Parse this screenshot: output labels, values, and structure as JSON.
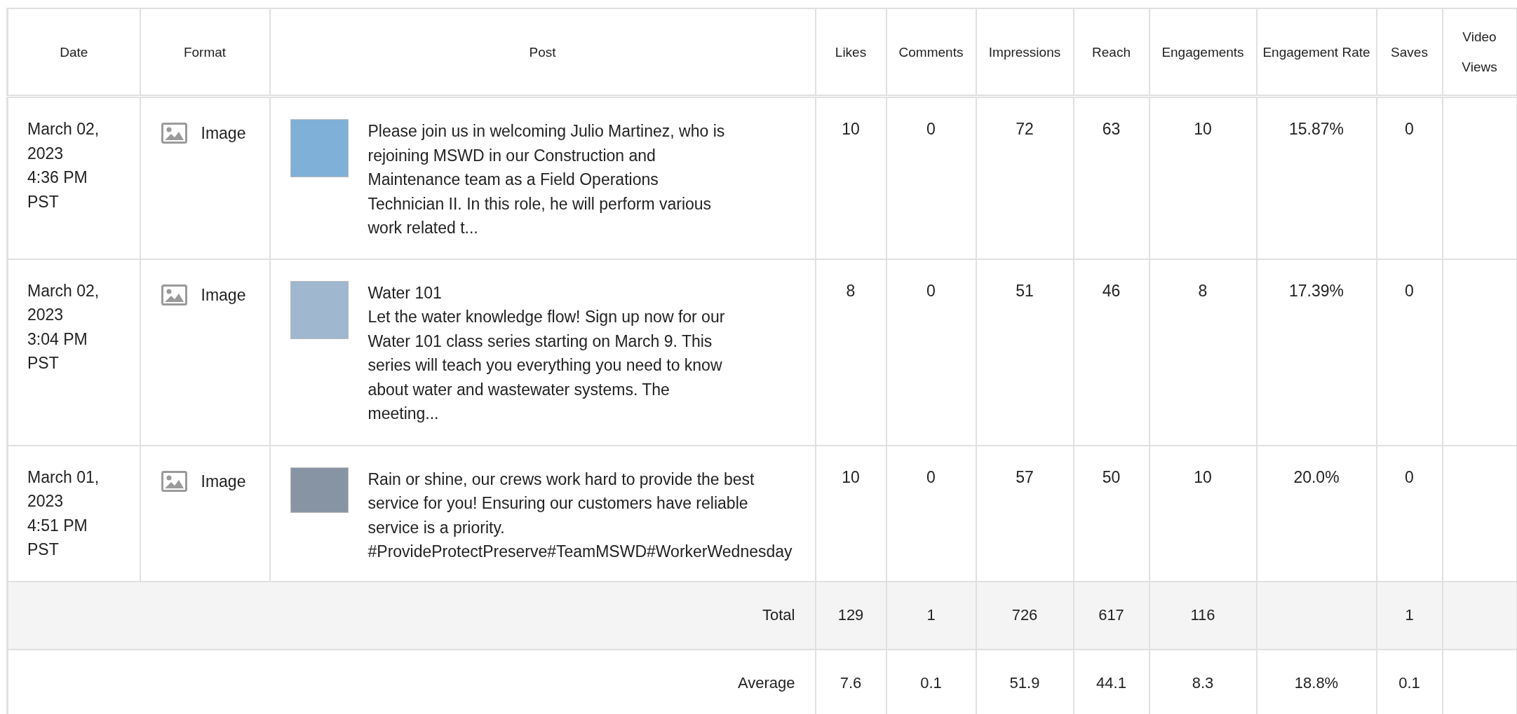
{
  "table": {
    "columns": [
      "Date",
      "Format",
      "Post",
      "Likes",
      "Comments",
      "Impressions",
      "Reach",
      "Engagements",
      "Engagement Rate",
      "Saves",
      "Video Views"
    ],
    "rows": [
      {
        "date": [
          "March 02, 2023",
          "4:36 PM",
          "PST"
        ],
        "format": "Image",
        "post": "Please join us in welcoming Julio Martinez, who is rejoining MSWD in our Construction and Maintenance team as a Field Operations Technician II. In this role, he will perform various work related t...",
        "metrics": {
          "likes": "10",
          "comments": "0",
          "impressions": "72",
          "reach": "63",
          "engagements": "10",
          "engagement_rate": "15.87%",
          "saves": "0"
        }
      },
      {
        "date": [
          "March 02, 2023",
          "3:04 PM",
          "PST"
        ],
        "format": "Image",
        "title": "Water 101",
        "post": "Let the water knowledge flow! Sign up now for our Water 101 class series starting on March 9. This series will teach you everything you need to know about water and wastewater systems. The meeting...",
        "metrics": {
          "likes": "8",
          "comments": "0",
          "impressions": "51",
          "reach": "46",
          "engagements": "8",
          "engagement_rate": "17.39%",
          "saves": "0"
        }
      },
      {
        "date": [
          "March 01, 2023",
          "4:51 PM",
          "PST"
        ],
        "format": "Image",
        "post": "Rain or shine, our crews work hard to provide the best service for you! Ensuring our customers have reliable service is a priority. #ProvideProtectPreserve#TeamMSWD#WorkerWednesday",
        "metrics": {
          "likes": "10",
          "comments": "0",
          "impressions": "57",
          "reach": "50",
          "engagements": "10",
          "engagement_rate": "20.0%",
          "saves": "0"
        }
      }
    ],
    "summary": [
      {
        "label": "Total",
        "metrics": {
          "likes": "129",
          "comments": "1",
          "impressions": "726",
          "reach": "617",
          "engagements": "116",
          "saves": "1"
        }
      },
      {
        "label": "Average",
        "metrics": {
          "likes": "7.6",
          "comments": "0.1",
          "impressions": "51.9",
          "reach": "44.1",
          "engagements": "8.3",
          "engagement_rate": "18.8%",
          "saves": "0.1"
        }
      }
    ]
  }
}
